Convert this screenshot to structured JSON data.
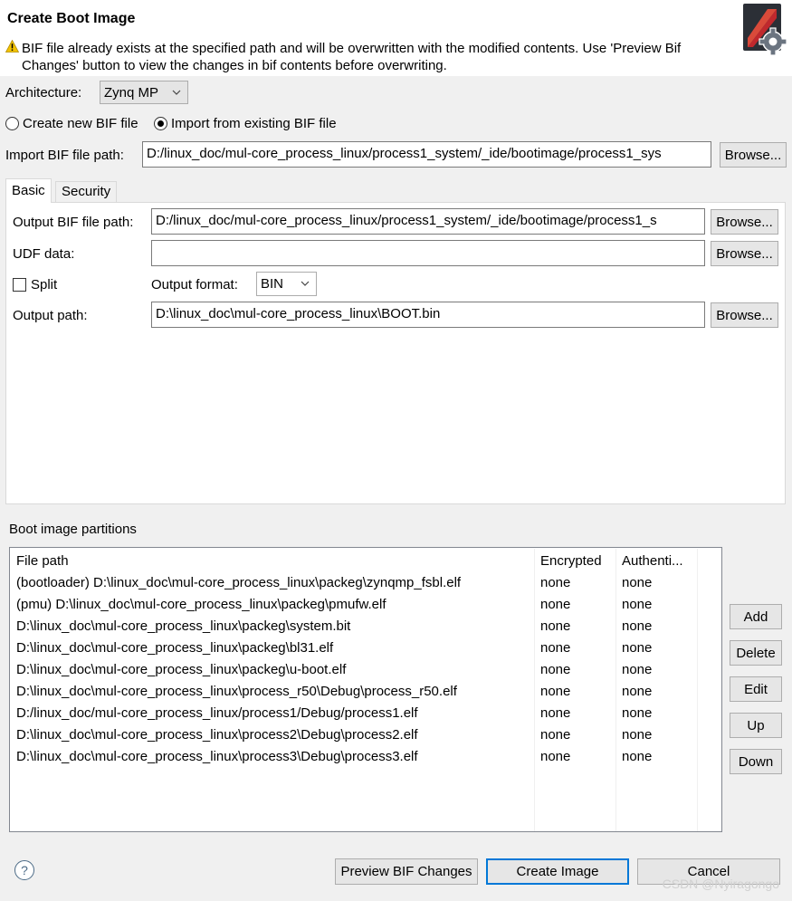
{
  "dialog": {
    "title": "Create Boot Image",
    "warning_message": "BIF file already exists at the specified path and will be overwritten with the modified contents. Use 'Preview Bif Changes' button to view the changes in bif contents before overwriting."
  },
  "architecture": {
    "label": "Architecture:",
    "selected": "Zynq MP"
  },
  "bif_mode": {
    "create_label": "Create new BIF file",
    "import_label": "Import from existing BIF file",
    "selected": "import"
  },
  "import_bif": {
    "label": "Import BIF file path:",
    "value": "D:/linux_doc/mul-core_process_linux/process1_system/_ide/bootimage/process1_sys",
    "browse_label": "Browse..."
  },
  "tabs": [
    {
      "label": "Basic",
      "active": true
    },
    {
      "label": "Security",
      "active": false
    }
  ],
  "basic": {
    "output_bif_label": "Output BIF file path:",
    "output_bif_value": "D:/linux_doc/mul-core_process_linux/process1_system/_ide/bootimage/process1_s",
    "output_bif_browse": "Browse...",
    "udf_label": "UDF data:",
    "udf_value": "",
    "udf_browse": "Browse...",
    "split_label": "Split",
    "split_checked": false,
    "output_format_label": "Output format:",
    "output_format_value": "BIN",
    "output_path_label": "Output path:",
    "output_path_value": "D:\\linux_doc\\mul-core_process_linux\\BOOT.bin",
    "output_path_browse": "Browse..."
  },
  "partitions": {
    "label": "Boot image partitions",
    "headers": [
      "File path",
      "Encrypted",
      "Authenti..."
    ],
    "rows": [
      {
        "path": "(bootloader) D:\\linux_doc\\mul-core_process_linux\\packeg\\zynqmp_fsbl.elf",
        "encrypted": "none",
        "auth": "none"
      },
      {
        "path": "(pmu) D:\\linux_doc\\mul-core_process_linux\\packeg\\pmufw.elf",
        "encrypted": "none",
        "auth": "none"
      },
      {
        "path": "D:\\linux_doc\\mul-core_process_linux\\packeg\\system.bit",
        "encrypted": "none",
        "auth": "none"
      },
      {
        "path": "D:\\linux_doc\\mul-core_process_linux\\packeg\\bl31.elf",
        "encrypted": "none",
        "auth": "none"
      },
      {
        "path": "D:\\linux_doc\\mul-core_process_linux\\packeg\\u-boot.elf",
        "encrypted": "none",
        "auth": "none"
      },
      {
        "path": "D:\\linux_doc\\mul-core_process_linux\\process_r50\\Debug\\process_r50.elf",
        "encrypted": "none",
        "auth": "none"
      },
      {
        "path": "D:/linux_doc/mul-core_process_linux/process1/Debug/process1.elf",
        "encrypted": "none",
        "auth": "none"
      },
      {
        "path": "D:\\linux_doc\\mul-core_process_linux\\process2\\Debug\\process2.elf",
        "encrypted": "none",
        "auth": "none"
      },
      {
        "path": "D:\\linux_doc\\mul-core_process_linux\\process3\\Debug\\process3.elf",
        "encrypted": "none",
        "auth": "none"
      }
    ],
    "buttons": {
      "add": "Add",
      "delete": "Delete",
      "edit": "Edit",
      "up": "Up",
      "down": "Down"
    }
  },
  "footer": {
    "help_glyph": "?",
    "preview_label": "Preview BIF Changes",
    "create_label": "Create Image",
    "cancel_label": "Cancel",
    "watermark": "CSDN @Nyiragongo"
  },
  "icons": {
    "warning": "warning-icon",
    "logo": "boot-image-gear-icon",
    "help": "help-icon"
  },
  "colors": {
    "accent": "#0078d7",
    "warning": "#f2c200",
    "logo_red": "#c0282d",
    "logo_dark": "#2b2f36"
  }
}
